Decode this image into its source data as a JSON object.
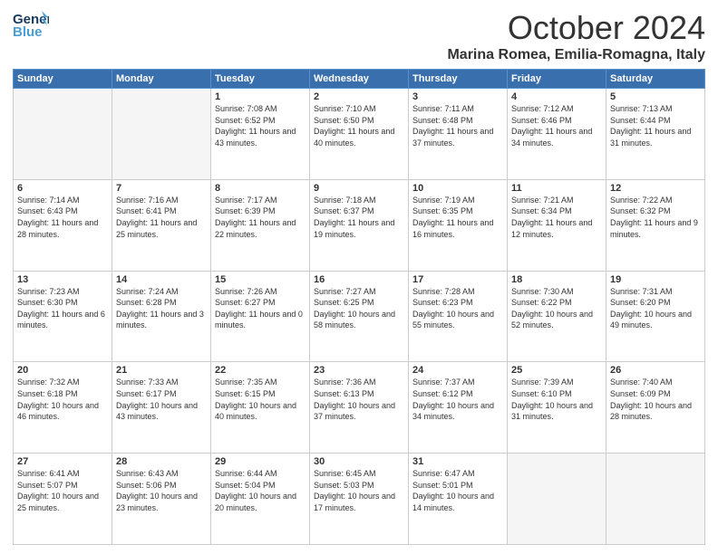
{
  "header": {
    "logo_general": "General",
    "logo_blue": "Blue",
    "month": "October 2024",
    "location": "Marina Romea, Emilia-Romagna, Italy"
  },
  "weekdays": [
    "Sunday",
    "Monday",
    "Tuesday",
    "Wednesday",
    "Thursday",
    "Friday",
    "Saturday"
  ],
  "weeks": [
    [
      {
        "day": "",
        "sunrise": "",
        "sunset": "",
        "daylight": ""
      },
      {
        "day": "",
        "sunrise": "",
        "sunset": "",
        "daylight": ""
      },
      {
        "day": "1",
        "sunrise": "Sunrise: 7:08 AM",
        "sunset": "Sunset: 6:52 PM",
        "daylight": "Daylight: 11 hours and 43 minutes."
      },
      {
        "day": "2",
        "sunrise": "Sunrise: 7:10 AM",
        "sunset": "Sunset: 6:50 PM",
        "daylight": "Daylight: 11 hours and 40 minutes."
      },
      {
        "day": "3",
        "sunrise": "Sunrise: 7:11 AM",
        "sunset": "Sunset: 6:48 PM",
        "daylight": "Daylight: 11 hours and 37 minutes."
      },
      {
        "day": "4",
        "sunrise": "Sunrise: 7:12 AM",
        "sunset": "Sunset: 6:46 PM",
        "daylight": "Daylight: 11 hours and 34 minutes."
      },
      {
        "day": "5",
        "sunrise": "Sunrise: 7:13 AM",
        "sunset": "Sunset: 6:44 PM",
        "daylight": "Daylight: 11 hours and 31 minutes."
      }
    ],
    [
      {
        "day": "6",
        "sunrise": "Sunrise: 7:14 AM",
        "sunset": "Sunset: 6:43 PM",
        "daylight": "Daylight: 11 hours and 28 minutes."
      },
      {
        "day": "7",
        "sunrise": "Sunrise: 7:16 AM",
        "sunset": "Sunset: 6:41 PM",
        "daylight": "Daylight: 11 hours and 25 minutes."
      },
      {
        "day": "8",
        "sunrise": "Sunrise: 7:17 AM",
        "sunset": "Sunset: 6:39 PM",
        "daylight": "Daylight: 11 hours and 22 minutes."
      },
      {
        "day": "9",
        "sunrise": "Sunrise: 7:18 AM",
        "sunset": "Sunset: 6:37 PM",
        "daylight": "Daylight: 11 hours and 19 minutes."
      },
      {
        "day": "10",
        "sunrise": "Sunrise: 7:19 AM",
        "sunset": "Sunset: 6:35 PM",
        "daylight": "Daylight: 11 hours and 16 minutes."
      },
      {
        "day": "11",
        "sunrise": "Sunrise: 7:21 AM",
        "sunset": "Sunset: 6:34 PM",
        "daylight": "Daylight: 11 hours and 12 minutes."
      },
      {
        "day": "12",
        "sunrise": "Sunrise: 7:22 AM",
        "sunset": "Sunset: 6:32 PM",
        "daylight": "Daylight: 11 hours and 9 minutes."
      }
    ],
    [
      {
        "day": "13",
        "sunrise": "Sunrise: 7:23 AM",
        "sunset": "Sunset: 6:30 PM",
        "daylight": "Daylight: 11 hours and 6 minutes."
      },
      {
        "day": "14",
        "sunrise": "Sunrise: 7:24 AM",
        "sunset": "Sunset: 6:28 PM",
        "daylight": "Daylight: 11 hours and 3 minutes."
      },
      {
        "day": "15",
        "sunrise": "Sunrise: 7:26 AM",
        "sunset": "Sunset: 6:27 PM",
        "daylight": "Daylight: 11 hours and 0 minutes."
      },
      {
        "day": "16",
        "sunrise": "Sunrise: 7:27 AM",
        "sunset": "Sunset: 6:25 PM",
        "daylight": "Daylight: 10 hours and 58 minutes."
      },
      {
        "day": "17",
        "sunrise": "Sunrise: 7:28 AM",
        "sunset": "Sunset: 6:23 PM",
        "daylight": "Daylight: 10 hours and 55 minutes."
      },
      {
        "day": "18",
        "sunrise": "Sunrise: 7:30 AM",
        "sunset": "Sunset: 6:22 PM",
        "daylight": "Daylight: 10 hours and 52 minutes."
      },
      {
        "day": "19",
        "sunrise": "Sunrise: 7:31 AM",
        "sunset": "Sunset: 6:20 PM",
        "daylight": "Daylight: 10 hours and 49 minutes."
      }
    ],
    [
      {
        "day": "20",
        "sunrise": "Sunrise: 7:32 AM",
        "sunset": "Sunset: 6:18 PM",
        "daylight": "Daylight: 10 hours and 46 minutes."
      },
      {
        "day": "21",
        "sunrise": "Sunrise: 7:33 AM",
        "sunset": "Sunset: 6:17 PM",
        "daylight": "Daylight: 10 hours and 43 minutes."
      },
      {
        "day": "22",
        "sunrise": "Sunrise: 7:35 AM",
        "sunset": "Sunset: 6:15 PM",
        "daylight": "Daylight: 10 hours and 40 minutes."
      },
      {
        "day": "23",
        "sunrise": "Sunrise: 7:36 AM",
        "sunset": "Sunset: 6:13 PM",
        "daylight": "Daylight: 10 hours and 37 minutes."
      },
      {
        "day": "24",
        "sunrise": "Sunrise: 7:37 AM",
        "sunset": "Sunset: 6:12 PM",
        "daylight": "Daylight: 10 hours and 34 minutes."
      },
      {
        "day": "25",
        "sunrise": "Sunrise: 7:39 AM",
        "sunset": "Sunset: 6:10 PM",
        "daylight": "Daylight: 10 hours and 31 minutes."
      },
      {
        "day": "26",
        "sunrise": "Sunrise: 7:40 AM",
        "sunset": "Sunset: 6:09 PM",
        "daylight": "Daylight: 10 hours and 28 minutes."
      }
    ],
    [
      {
        "day": "27",
        "sunrise": "Sunrise: 6:41 AM",
        "sunset": "Sunset: 5:07 PM",
        "daylight": "Daylight: 10 hours and 25 minutes."
      },
      {
        "day": "28",
        "sunrise": "Sunrise: 6:43 AM",
        "sunset": "Sunset: 5:06 PM",
        "daylight": "Daylight: 10 hours and 23 minutes."
      },
      {
        "day": "29",
        "sunrise": "Sunrise: 6:44 AM",
        "sunset": "Sunset: 5:04 PM",
        "daylight": "Daylight: 10 hours and 20 minutes."
      },
      {
        "day": "30",
        "sunrise": "Sunrise: 6:45 AM",
        "sunset": "Sunset: 5:03 PM",
        "daylight": "Daylight: 10 hours and 17 minutes."
      },
      {
        "day": "31",
        "sunrise": "Sunrise: 6:47 AM",
        "sunset": "Sunset: 5:01 PM",
        "daylight": "Daylight: 10 hours and 14 minutes."
      },
      {
        "day": "",
        "sunrise": "",
        "sunset": "",
        "daylight": ""
      },
      {
        "day": "",
        "sunrise": "",
        "sunset": "",
        "daylight": ""
      }
    ]
  ]
}
